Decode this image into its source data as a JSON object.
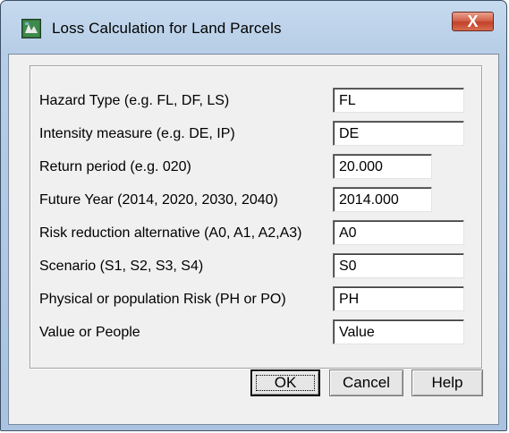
{
  "window": {
    "title": "Loss Calculation for Land Parcels",
    "close_symbol": "X"
  },
  "form": {
    "rows": [
      {
        "label": "Hazard Type (e.g. FL, DF, LS)",
        "value": "FL"
      },
      {
        "label": "Intensity measure (e.g. DE, IP)",
        "value": "DE"
      },
      {
        "label": "Return period (e.g. 020)",
        "value": "20.000"
      },
      {
        "label": "Future Year (2014, 2020, 2030, 2040)",
        "value": "2014.000"
      },
      {
        "label": "Risk reduction alternative (A0, A1, A2,A3)",
        "value": "A0"
      },
      {
        "label": "Scenario (S1, S2, S3, S4)",
        "value": "S0"
      },
      {
        "label": "Physical or population Risk (PH or PO)",
        "value": "PH"
      },
      {
        "label": "Value or People",
        "value": "Value"
      }
    ]
  },
  "buttons": {
    "ok": "OK",
    "cancel": "Cancel",
    "help": "Help"
  },
  "icons": {
    "app": "app-icon",
    "close": "close-icon"
  },
  "colors": {
    "close_button": "#c94a32",
    "title_bar": "#b9d1ea",
    "dialog_face": "#f0f0f0"
  }
}
